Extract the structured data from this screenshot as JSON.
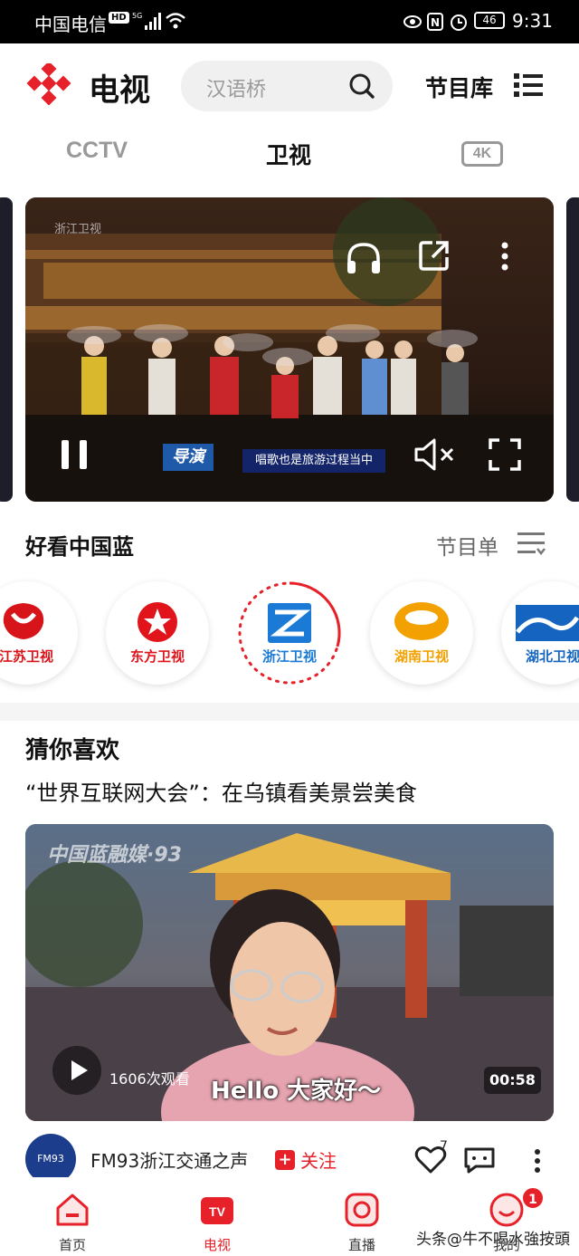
{
  "status_bar": {
    "carrier": "中国电信",
    "hd": "HD",
    "network": "5G",
    "battery": "46",
    "time": "9:31"
  },
  "header": {
    "brand": "电视",
    "search_placeholder": "汉语桥",
    "library_label": "节目库"
  },
  "tabs": [
    {
      "label": "CCTV",
      "active": false
    },
    {
      "label": "卫视",
      "active": true
    },
    {
      "label": "4K",
      "active": false
    }
  ],
  "player": {
    "channel_watermark": "浙江卫视",
    "tag": "导演",
    "caption": "唱歌也是旅游过程当中"
  },
  "channels_section": {
    "title": "好看中国蓝",
    "program_list_label": "节目单",
    "channels": [
      {
        "name": "江苏卫视",
        "color": "#d8141b"
      },
      {
        "name": "东方卫视",
        "color": "#e0141a"
      },
      {
        "name": "浙江卫视",
        "color": "#1a7ad6"
      },
      {
        "name": "湖南卫视",
        "color": "#f2a100"
      },
      {
        "name": "湖北卫视",
        "color": "#1565c0"
      }
    ]
  },
  "recommend": {
    "title": "猜你喜欢",
    "headline": "“世界互联网大会”：在乌镇看美景尝美食",
    "video": {
      "watermark": "中国蓝融媒·93",
      "views": "1606次观看",
      "subtitle": "Hello 大家好～",
      "duration": "00:58"
    },
    "author": {
      "avatar_text": "FM93",
      "name": "FM93浙江交通之声",
      "follow_plus": "+",
      "follow_label": "关注",
      "like_count": "7"
    }
  },
  "bottom_nav": {
    "items": [
      {
        "label": "首页"
      },
      {
        "label": "电视"
      },
      {
        "label": "直播"
      },
      {
        "label": "我的"
      }
    ],
    "badge": "1",
    "watermark": "头条@牛不喝水強按頭"
  },
  "colors": {
    "accent": "#e62129",
    "muted": "#999999"
  }
}
